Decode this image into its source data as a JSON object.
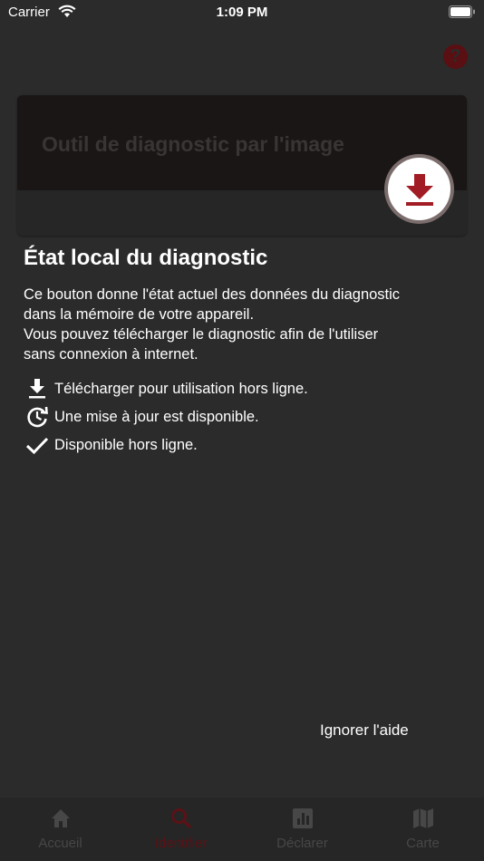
{
  "status_bar": {
    "carrier": "Carrier",
    "time": "1:09 PM"
  },
  "card": {
    "title": "Outil de diagnostic par l'image"
  },
  "help": {
    "title": "État local du diagnostic",
    "paragraph_line1": "Ce bouton donne l'état actuel des données du diagnostic",
    "paragraph_line2": "dans la mémoire de votre appareil.",
    "paragraph_line3": "Vous pouvez télécharger le diagnostic afin de l'utiliser",
    "paragraph_line4": "sans connexion à internet.",
    "legend": [
      {
        "icon": "download-icon",
        "label": "Télécharger pour utilisation hors ligne."
      },
      {
        "icon": "update-icon",
        "label": "Une mise à jour est disponible."
      },
      {
        "icon": "checkmark-icon",
        "label": "Disponible hors ligne."
      }
    ],
    "skip_label": "Ignorer l'aide"
  },
  "tabs": [
    {
      "label": "Accueil",
      "icon": "home-icon",
      "active": false
    },
    {
      "label": "Identifier",
      "icon": "search-icon",
      "active": true
    },
    {
      "label": "Déclarer",
      "icon": "chart-icon",
      "active": false
    },
    {
      "label": "Carte",
      "icon": "map-icon",
      "active": false
    }
  ],
  "colors": {
    "background": "#2b2b2b",
    "accent": "#a11c24",
    "accent_dimmed": "#5a1216"
  }
}
